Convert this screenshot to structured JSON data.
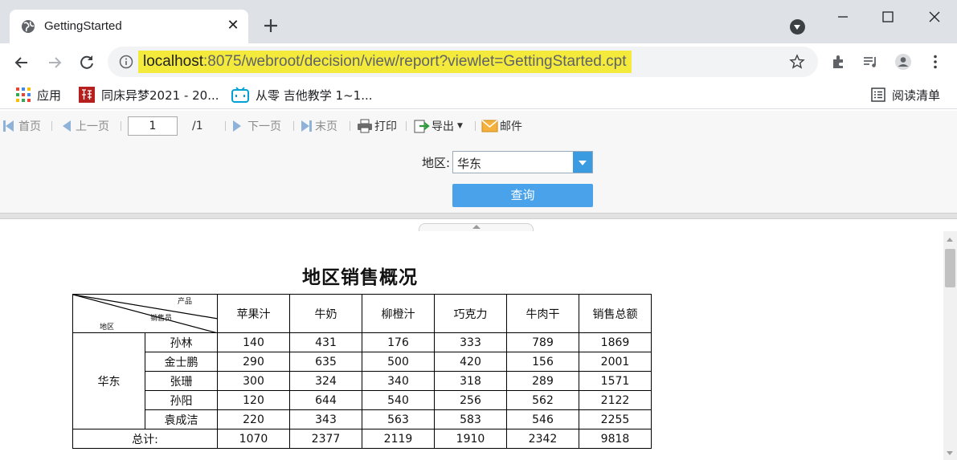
{
  "browser": {
    "tab_title": "GettingStarted",
    "url_host": "localhost",
    "url_rest": ":8075/webroot/decision/view/report?viewlet=GettingStarted.cpt",
    "bookmarks": [
      {
        "label": "应用",
        "icon": "apps-grid-icon"
      },
      {
        "label": "同床异梦2021 - 20...",
        "icon": "han-logo-icon"
      },
      {
        "label": "从零 吉他教学 1~1...",
        "icon": "bilibili-tv-icon"
      }
    ],
    "reading_list": "阅读清单"
  },
  "report_toolbar": {
    "first": "首页",
    "prev": "上一页",
    "page_value": "1",
    "page_total": "/1",
    "next": "下一页",
    "last": "末页",
    "print": "打印",
    "export": "导出",
    "mail": "邮件"
  },
  "params": {
    "region_label": "地区:",
    "region_value": "华东",
    "query_label": "查询"
  },
  "report": {
    "title": "地区销售概况",
    "header_diag": {
      "product": "产品",
      "salesperson": "销售员",
      "region": "地区"
    },
    "columns": [
      "苹果汁",
      "牛奶",
      "柳橙汁",
      "巧克力",
      "牛肉干",
      "销售总额"
    ],
    "region": "华东",
    "rows": [
      {
        "name": "孙林",
        "values": [
          "140",
          "431",
          "176",
          "333",
          "789",
          "1869"
        ]
      },
      {
        "name": "金士鹏",
        "values": [
          "290",
          "635",
          "500",
          "420",
          "156",
          "2001"
        ]
      },
      {
        "name": "张珊",
        "values": [
          "300",
          "324",
          "340",
          "318",
          "289",
          "1571"
        ]
      },
      {
        "name": "孙阳",
        "values": [
          "120",
          "644",
          "540",
          "256",
          "562",
          "2122"
        ]
      },
      {
        "name": "袁成洁",
        "values": [
          "220",
          "343",
          "563",
          "583",
          "546",
          "2255"
        ]
      }
    ],
    "total_label": "总计:",
    "totals": [
      "1070",
      "2377",
      "2119",
      "1910",
      "2342",
      "9818"
    ]
  }
}
